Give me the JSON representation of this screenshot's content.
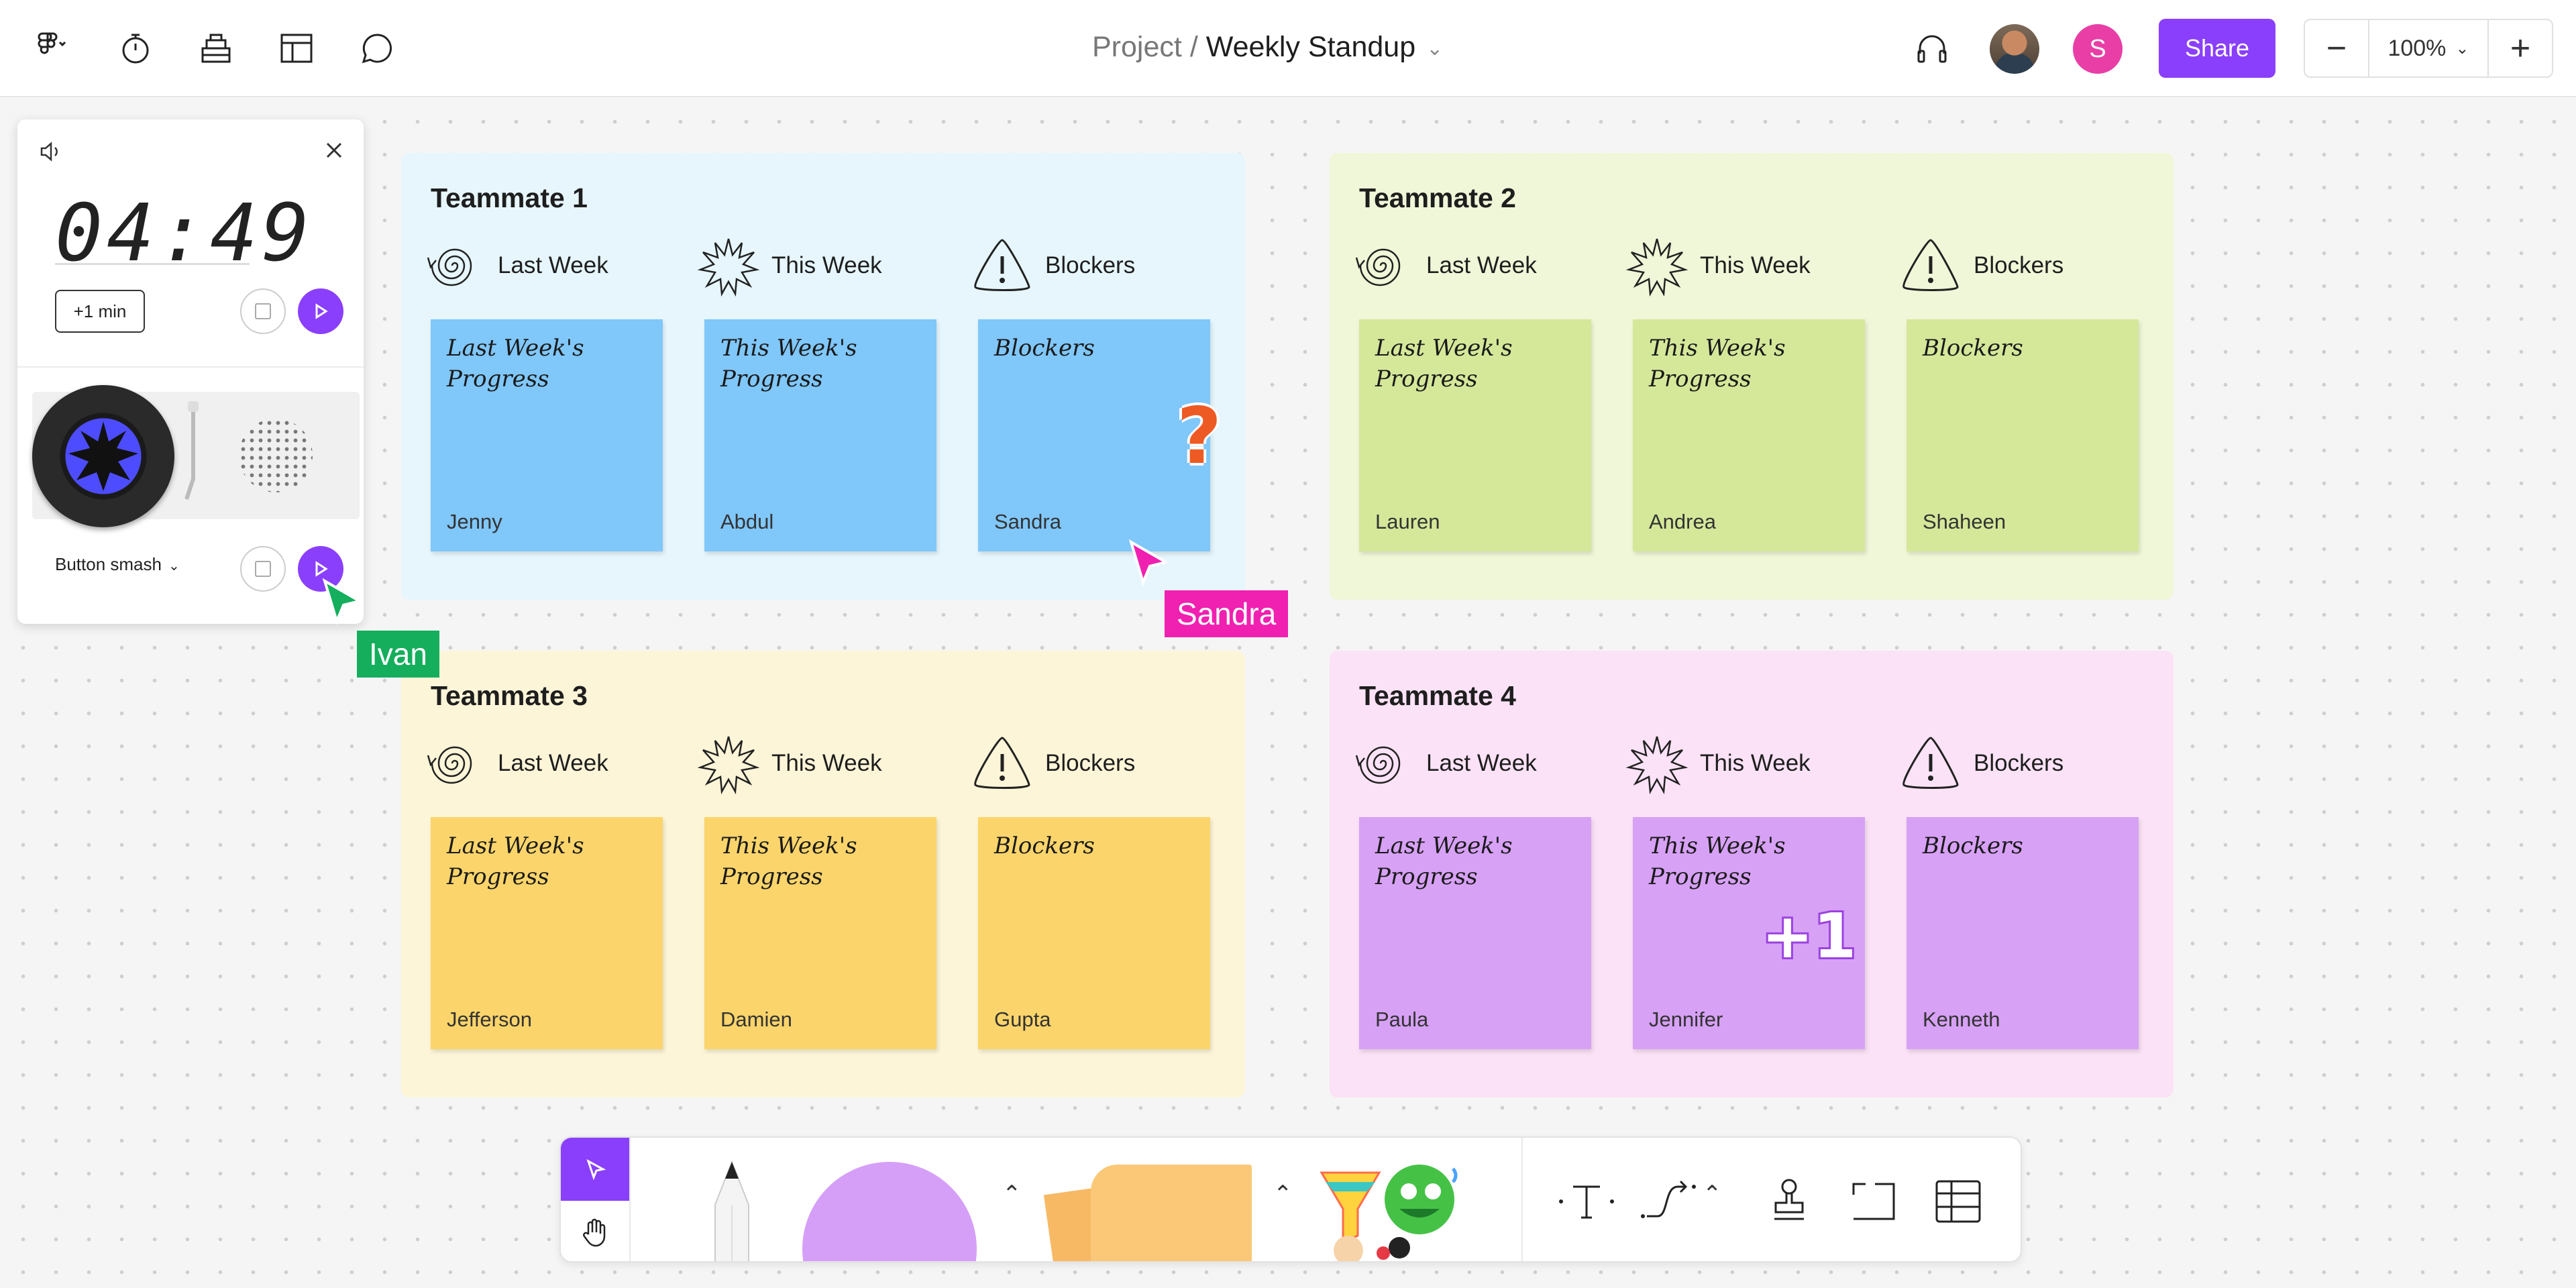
{
  "breadcrumb": {
    "project": "Project",
    "separator": "/",
    "file": "Weekly Standup"
  },
  "share_label": "Share",
  "zoom": {
    "value": "100%",
    "minus": "−",
    "plus": "+"
  },
  "user_avatar_initial": "S",
  "timer": {
    "time": "04:49",
    "add_minute_label": "+1 min",
    "music_label": "Button smash"
  },
  "cursors": {
    "ivan": {
      "name": "Ivan",
      "color": "#14ae5c"
    },
    "sandra": {
      "name": "Sandra",
      "color": "#f020b0"
    }
  },
  "columns": {
    "last_week": "Last Week",
    "this_week": "This Week",
    "blockers": "Blockers"
  },
  "sticky_titles": {
    "last_week": "Last Week's Progress",
    "this_week": "This Week's Progress",
    "blockers": "Blockers"
  },
  "sections": [
    {
      "title": "Teammate 1",
      "bg": "#e6f6fc",
      "sticky_color": "#80c7fa",
      "names": [
        "Jenny",
        "Abdul",
        "Sandra"
      ]
    },
    {
      "title": "Teammate 2",
      "bg": "#f0f7d8",
      "sticky_color": "#d5e89a",
      "names": [
        "Lauren",
        "Andrea",
        "Shaheen"
      ]
    },
    {
      "title": "Teammate 3",
      "bg": "#fdf5d8",
      "sticky_color": "#fbd56b",
      "names": [
        "Jefferson",
        "Damien",
        "Gupta"
      ]
    },
    {
      "title": "Teammate 4",
      "bg": "#fbe2f6",
      "sticky_color": "#d7a1f5",
      "names": [
        "Paula",
        "Jennifer",
        "Kenneth"
      ]
    }
  ],
  "stamp_plus_one": "+1",
  "stamp_question": "?",
  "accent": "#8a3ffc"
}
